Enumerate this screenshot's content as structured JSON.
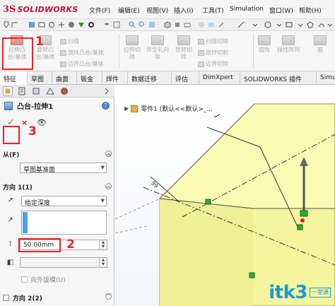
{
  "app": {
    "logo_ds": "3S",
    "logo_text": "SOLIDWORKS"
  },
  "menu": [
    "文件(F)",
    "编辑(E)",
    "视图(V)",
    "插入(I)",
    "工具(T)",
    "Simulation",
    "窗口(W)",
    "帮助(H)"
  ],
  "ribbon": {
    "extrude_boss": "拉伸凸台/基体",
    "revolve_boss": "旋转凸台/基体",
    "sweep": "扫描",
    "loft": "放样凸台/基体",
    "boundary_boss": "边界凸台/基体",
    "extrude_cut": "拉伸切除",
    "hole_wizard": "异型孔向导",
    "revolve_cut": "旋转切除",
    "swept_cut": "扫描切除",
    "lofted_cut": "放样切割",
    "boundary_cut": "边界切除",
    "fillet": "圆角",
    "linear_pattern": "线性阵列",
    "rib": "筋"
  },
  "tabs": [
    "特征",
    "草图",
    "曲面",
    "钣金",
    "焊件",
    "数据迁移",
    "评估",
    "DimXpert",
    "SOLIDWORKS 插件",
    "Simu"
  ],
  "property_manager": {
    "feature_title": "凸台-拉伸1",
    "help": "?",
    "ok": "✓",
    "cancel": "×",
    "from_label": "从(F)",
    "from_value": "草图基准面",
    "direction1_label": "方向 1(1)",
    "end_condition": "给定深度",
    "depth_value": "50.00mm",
    "draft_outward": "向外拔模(U)",
    "direction2_label": "方向 2(2)"
  },
  "annotations": {
    "n1": "1",
    "n2": "2",
    "n3": "3"
  },
  "graphics": {
    "breadcrumb": "零件1 (默认<<默认>_..."
  },
  "watermark": {
    "main": "itk3",
    "dot": ".com",
    "side1": "一堂课",
    "side2": ""
  },
  "colors": {
    "accent_red": "#e22222",
    "solid_fill": "#fbfbb4",
    "selection_blue": "#4aa3e6"
  }
}
